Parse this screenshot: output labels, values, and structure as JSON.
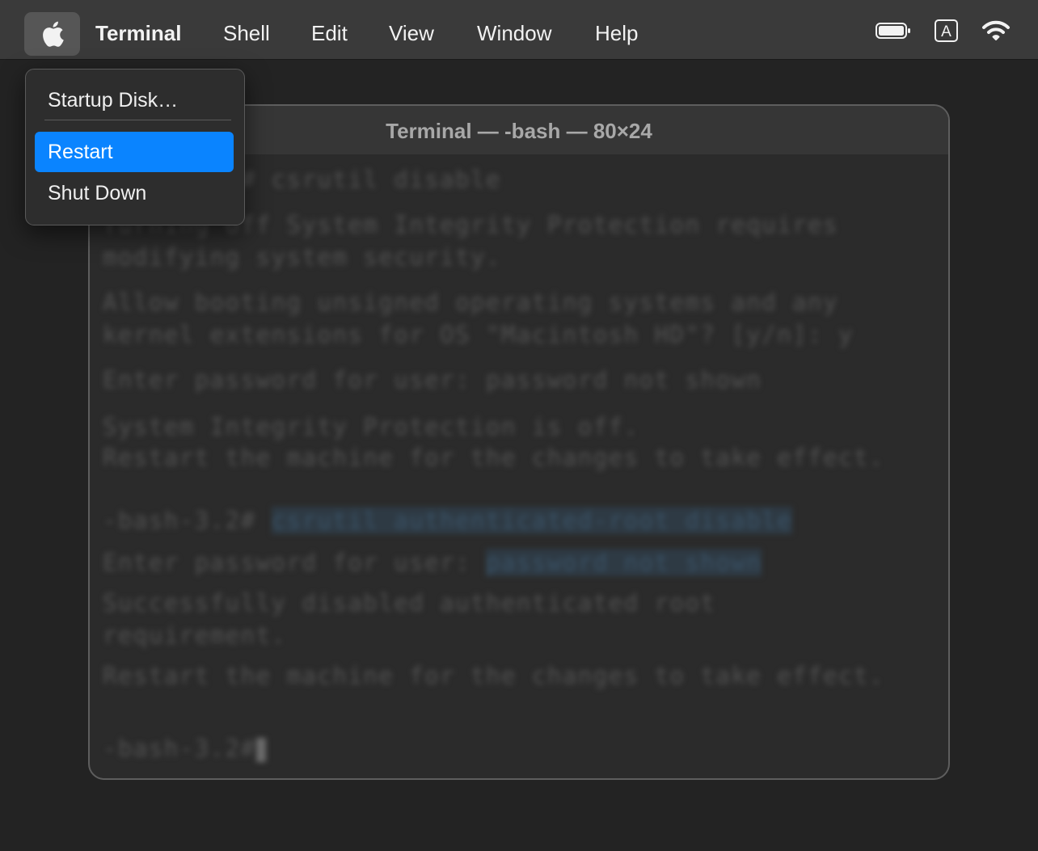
{
  "menubar": {
    "app_name": "Terminal",
    "items": [
      "Shell",
      "Edit",
      "View",
      "Window",
      "Help"
    ],
    "input_source": "A"
  },
  "apple_menu": {
    "items": [
      {
        "label": "Startup Disk…",
        "selected": false
      },
      {
        "label": "Restart",
        "selected": true
      },
      {
        "label": "Shut Down",
        "selected": false
      }
    ]
  },
  "terminal": {
    "title": "Terminal — -bash — 80×24",
    "lines": [
      "-bash-3.2# csrutil disable",
      "Turning off System Integrity Protection requires",
      "modifying system security.",
      "Allow booting unsigned operating systems and any",
      "kernel extensions for OS \"Macintosh HD\"? [y/n]: y",
      "Enter password for user: password not shown",
      "System Integrity Protection is off.",
      "Restart the machine for the changes to take effect.",
      "-bash-3.2#",
      "csrutil authenticated-root disable",
      "Enter password for user:",
      "password not shown",
      "Successfully disabled authenticated root",
      "requirement.",
      "Restart the machine for the changes to take effect.",
      "-bash-3.2#"
    ]
  },
  "colors": {
    "accent": "#0a84ff",
    "menubar_bg": "#3a3a3a",
    "desktop_bg": "#232323"
  },
  "icons": [
    "apple-logo-icon",
    "battery-icon",
    "input-source-icon",
    "wifi-icon"
  ]
}
